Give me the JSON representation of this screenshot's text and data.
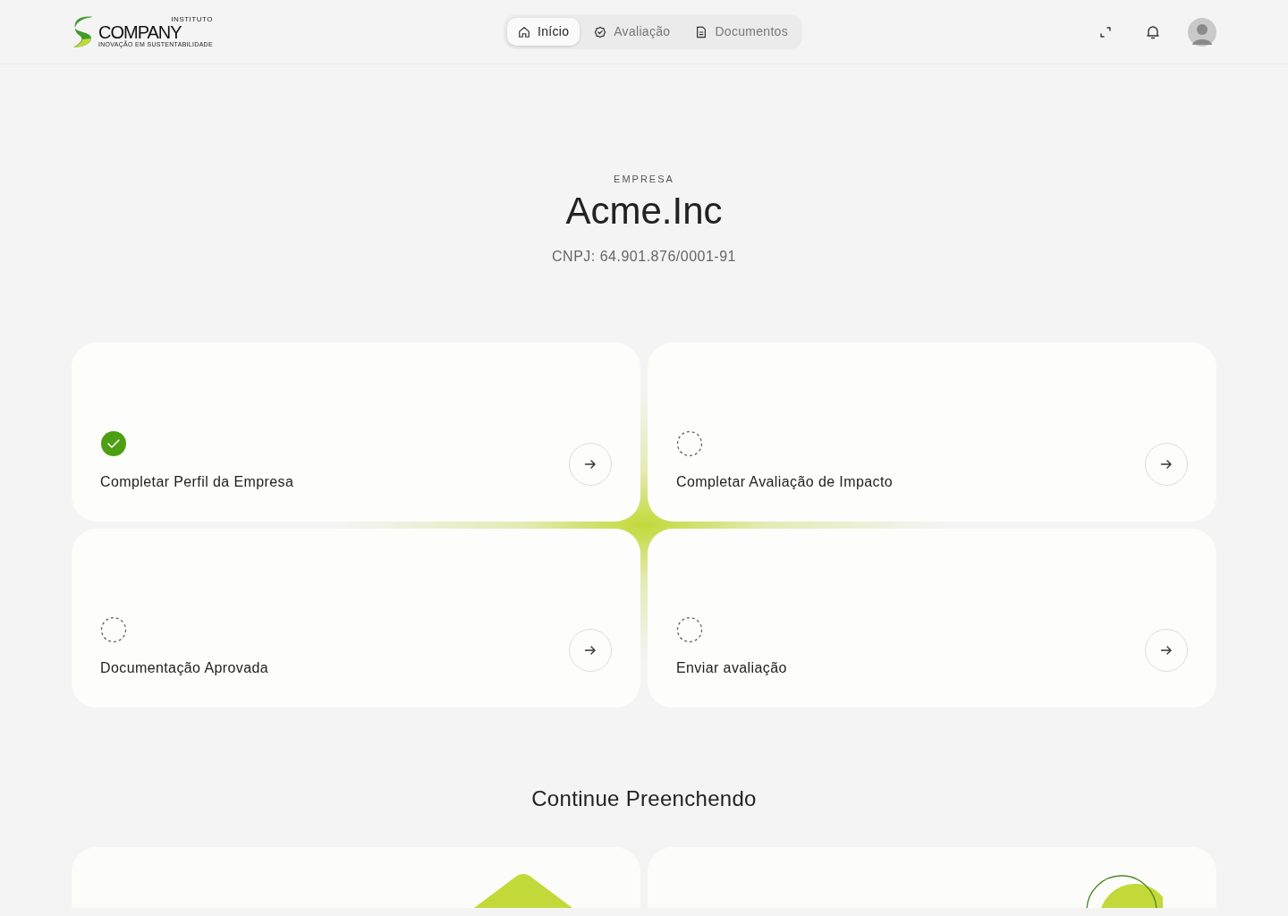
{
  "logo": {
    "top": "INSTITUTO",
    "name": "COMPANY",
    "tagline": "INOVAÇÃO EM SUSTENTABILIDADE"
  },
  "nav": [
    {
      "kind": "home",
      "label": "Início",
      "selected": true
    },
    {
      "kind": "badge",
      "label": "Avaliação",
      "selected": false
    },
    {
      "kind": "doc",
      "label": "Documentos",
      "selected": false
    }
  ],
  "hero": {
    "eyebrow": "EMPRESA",
    "title": "Acme.Inc",
    "subtitle": "CNPJ: 64.901.876/0001-91"
  },
  "steps": [
    {
      "label": "Completar Perfil da Empresa",
      "completed": true
    },
    {
      "label": "Completar Avaliação de Impacto",
      "completed": false
    },
    {
      "label": "Documentação Aprovada",
      "completed": false
    },
    {
      "label": "Enviar avaliação",
      "completed": false
    }
  ],
  "continue": {
    "title": "Continue Preenchendo",
    "cards": [
      {
        "kind": "diamond"
      },
      {
        "kind": "circle"
      }
    ]
  }
}
